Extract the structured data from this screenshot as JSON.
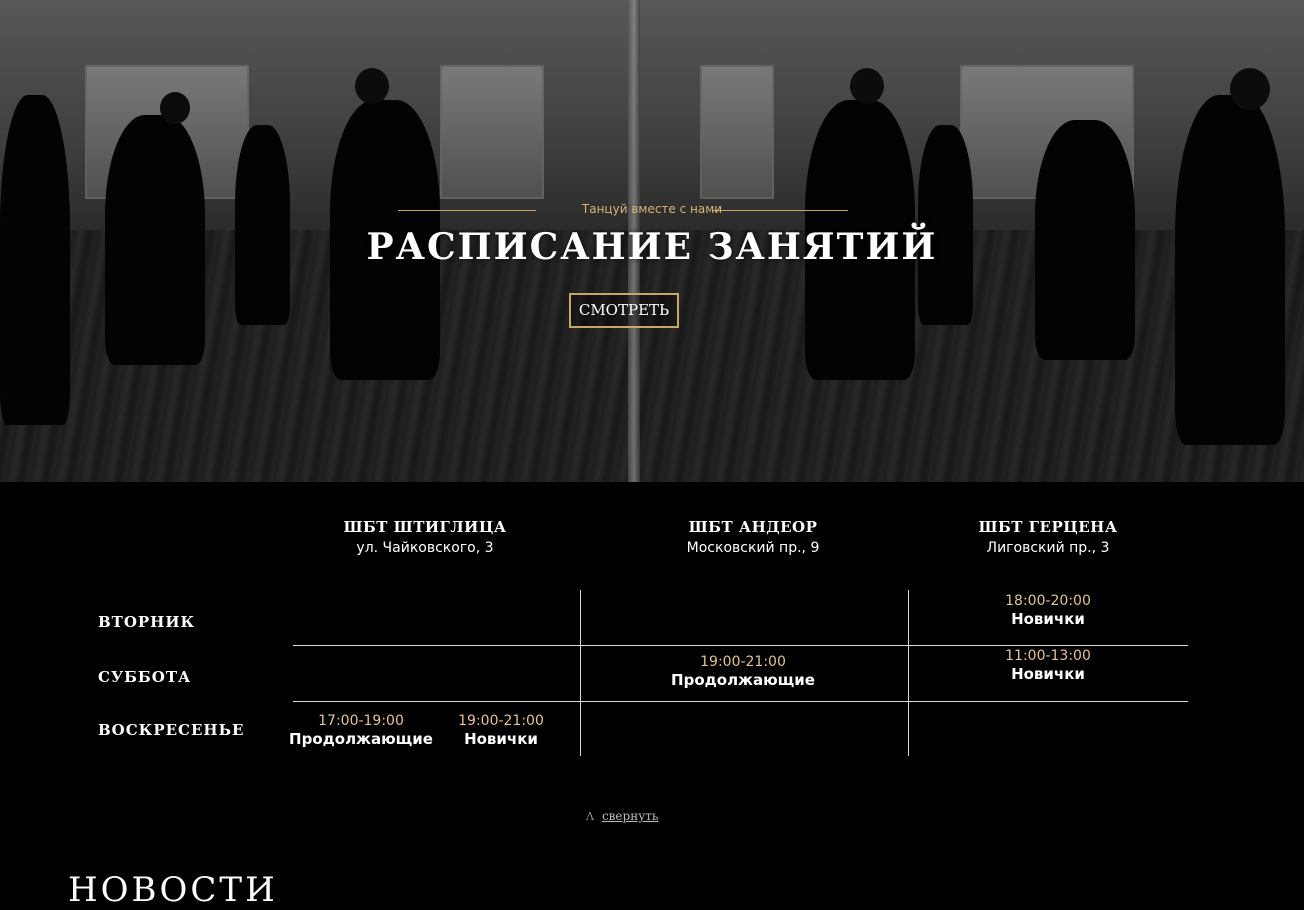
{
  "hero": {
    "tagline": "Танцуй вместе с нами",
    "title": "РАСПИСАНИЕ ЗАНЯТИЙ",
    "button_label": "СМОТРЕТЬ"
  },
  "schedule": {
    "venues": [
      {
        "name": "ШБТ ШТИГЛИЦА",
        "address": "ул. Чайковского, 3"
      },
      {
        "name": "ШБТ АНДЕОР",
        "address": "Московский пр., 9"
      },
      {
        "name": "ШБТ ГЕРЦЕНА",
        "address": "Лиговский пр., 3"
      }
    ],
    "days": [
      "ВТОРНИК",
      "СУББОТА",
      "ВОСКРЕСЕНЬЕ"
    ],
    "slots": {
      "tue_gertsena": {
        "time": "18:00-20:00",
        "level": "Новички"
      },
      "sat_andeor": {
        "time": "19:00-21:00",
        "level": "Продолжающие"
      },
      "sat_gertsena": {
        "time": "11:00-13:00",
        "level": "Новички"
      },
      "sun_shtiglitsa_1": {
        "time": "17:00-19:00",
        "level": "Продолжающие"
      },
      "sun_shtiglitsa_2": {
        "time": "19:00-21:00",
        "level": "Новички"
      }
    },
    "collapse_label": "свернуть",
    "collapse_icon": "chevron-up-icon"
  },
  "news": {
    "title": "НОВОСТИ"
  },
  "colors": {
    "accent_gold": "#c9a766",
    "time_gold": "#e3c489",
    "background": "#000000"
  }
}
